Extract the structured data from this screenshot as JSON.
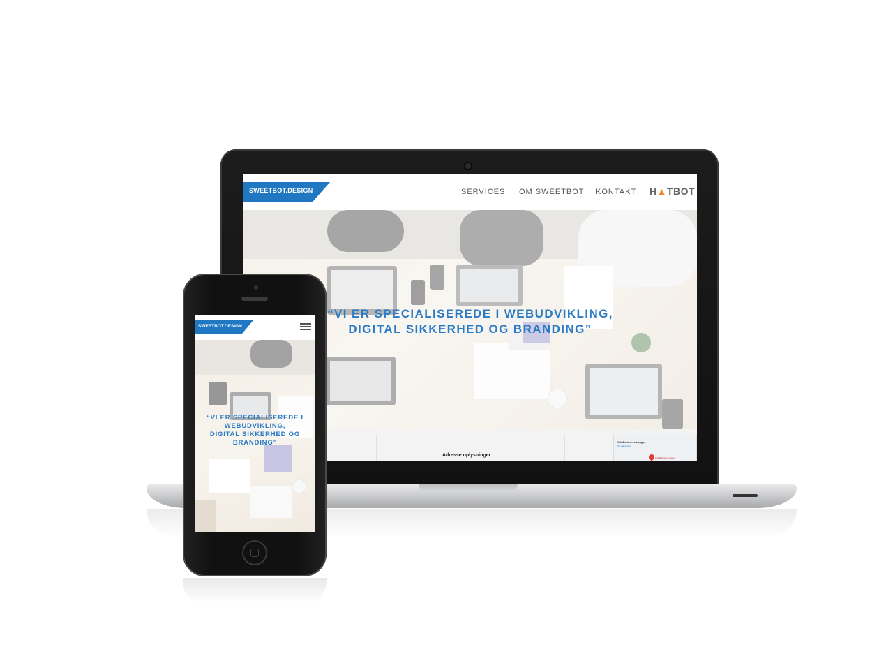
{
  "desktop": {
    "brand": "SWEETBOT.DESIGN",
    "nav": [
      {
        "label": "SERVICES"
      },
      {
        "label": "OM SWEETBOT"
      },
      {
        "label": "KONTAKT"
      }
    ],
    "partner_logo": {
      "prefix": "H",
      "flame": "▲",
      "suffix": "TBOT"
    },
    "hero_quote_line1": "“VI ER SPECIALISEREDE I WEBUDVIKLING,",
    "hero_quote_line2": "DIGITAL SIKKERHED OG BRANDING”",
    "address_label": "Adresse oplysninger:",
    "map": {
      "place": "CphBusiness Lyngby",
      "link": "Vis større kort",
      "pin_label": "CphBusiness Lyngby"
    }
  },
  "mobile": {
    "brand": "SWEETBOT.DESIGN",
    "menu_icon": "hamburger-icon",
    "hero_quote_line1": "“VI ER SPECIALISEREDE I",
    "hero_quote_line2": "WEBUDVIKLING,",
    "hero_quote_line3": "DIGITAL SIKKERHED OG",
    "hero_quote_line4": "BRANDING”"
  },
  "colors": {
    "accent": "#1f78c1",
    "quote": "#2a7bc4"
  }
}
